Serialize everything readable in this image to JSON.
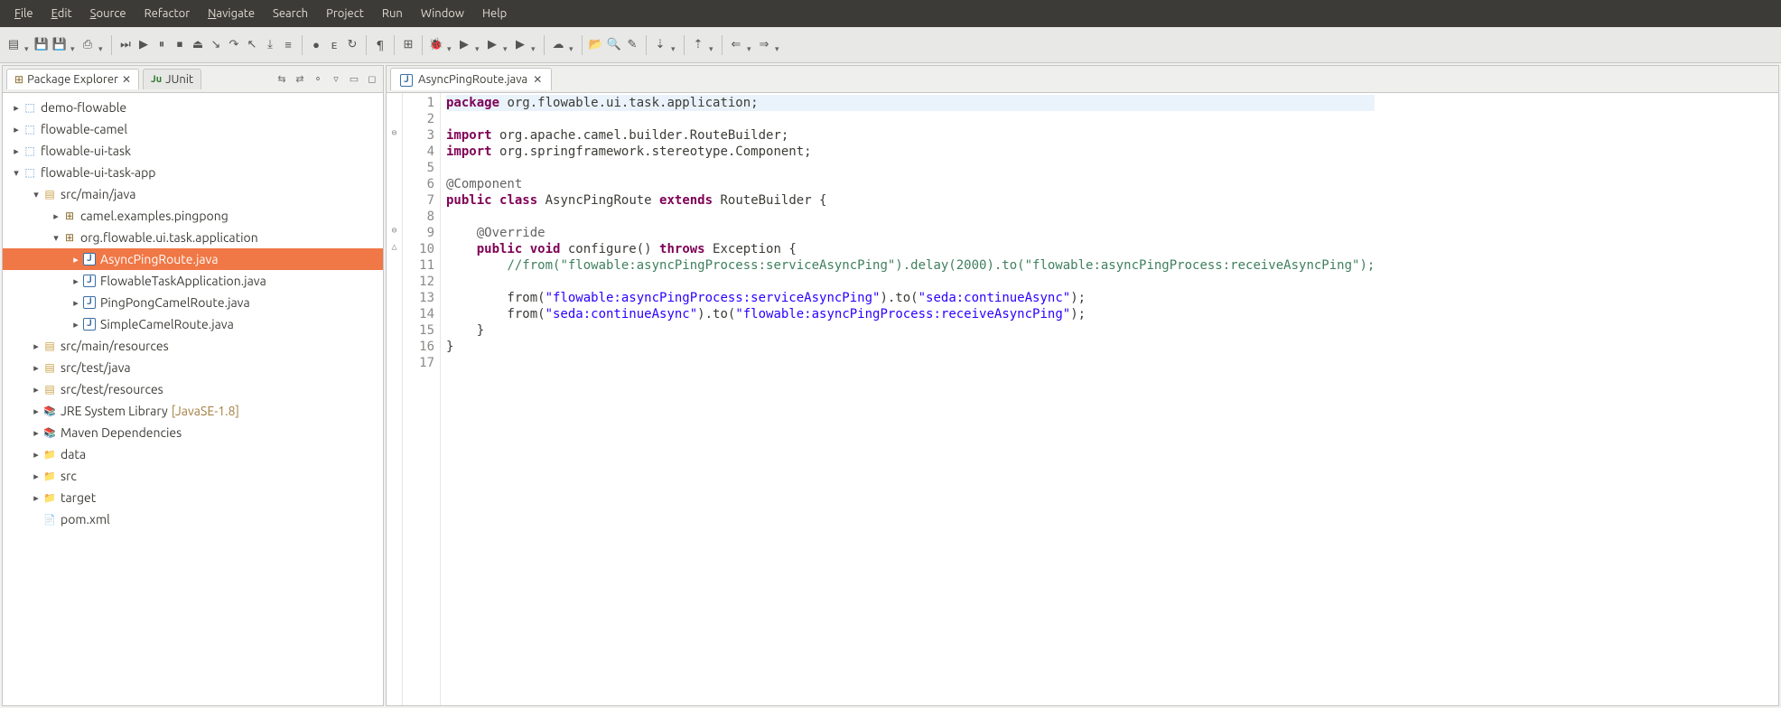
{
  "menu": [
    "File",
    "Edit",
    "Source",
    "Refactor",
    "Navigate",
    "Search",
    "Project",
    "Run",
    "Window",
    "Help"
  ],
  "menu_underline": [
    0,
    0,
    0,
    null,
    0,
    null,
    null,
    null,
    null,
    null
  ],
  "sidebar": {
    "tabs": [
      {
        "label": "Package Explorer",
        "active": true
      },
      {
        "label": "JUnit",
        "active": false
      }
    ]
  },
  "tree": [
    {
      "depth": 0,
      "arrow": "▸",
      "icon": "proj",
      "label": "demo-flowable"
    },
    {
      "depth": 0,
      "arrow": "▸",
      "icon": "proj",
      "label": "flowable-camel"
    },
    {
      "depth": 0,
      "arrow": "▸",
      "icon": "proj",
      "label": "flowable-ui-task"
    },
    {
      "depth": 0,
      "arrow": "▾",
      "icon": "proj",
      "label": "flowable-ui-task-app"
    },
    {
      "depth": 1,
      "arrow": "▾",
      "icon": "srcf",
      "label": "src/main/java"
    },
    {
      "depth": 2,
      "arrow": "▸",
      "icon": "pkg",
      "label": "camel.examples.pingpong"
    },
    {
      "depth": 2,
      "arrow": "▾",
      "icon": "pkg",
      "label": "org.flowable.ui.task.application"
    },
    {
      "depth": 3,
      "arrow": "▸",
      "icon": "jfile",
      "label": "AsyncPingRoute.java",
      "selected": true
    },
    {
      "depth": 3,
      "arrow": "▸",
      "icon": "jfile",
      "label": "FlowableTaskApplication.java"
    },
    {
      "depth": 3,
      "arrow": "▸",
      "icon": "jfile",
      "label": "PingPongCamelRoute.java"
    },
    {
      "depth": 3,
      "arrow": "▸",
      "icon": "jfile",
      "label": "SimpleCamelRoute.java"
    },
    {
      "depth": 1,
      "arrow": "▸",
      "icon": "srcf",
      "label": "src/main/resources"
    },
    {
      "depth": 1,
      "arrow": "▸",
      "icon": "srcf",
      "label": "src/test/java"
    },
    {
      "depth": 1,
      "arrow": "▸",
      "icon": "srcf",
      "label": "src/test/resources"
    },
    {
      "depth": 1,
      "arrow": "▸",
      "icon": "jar",
      "label": "JRE System Library",
      "suffix": "[JavaSE-1.8]"
    },
    {
      "depth": 1,
      "arrow": "▸",
      "icon": "jar",
      "label": "Maven Dependencies"
    },
    {
      "depth": 1,
      "arrow": "▸",
      "icon": "fold",
      "label": "data"
    },
    {
      "depth": 1,
      "arrow": "▸",
      "icon": "fold",
      "label": "src"
    },
    {
      "depth": 1,
      "arrow": "▸",
      "icon": "fold",
      "label": "target"
    },
    {
      "depth": 1,
      "arrow": "",
      "icon": "file",
      "label": "pom.xml"
    }
  ],
  "editor": {
    "tab_label": "AsyncPingRoute.java",
    "lines": [
      {
        "n": 1,
        "hl": true,
        "tokens": [
          [
            "kw",
            "package"
          ],
          [
            "",
            " org.flowable.ui.task.application;"
          ]
        ]
      },
      {
        "n": 2,
        "tokens": [
          [
            "",
            ""
          ]
        ]
      },
      {
        "n": 3,
        "marker": "⊖",
        "tokens": [
          [
            "kw",
            "import"
          ],
          [
            "",
            " org.apache.camel.builder.RouteBuilder;"
          ]
        ]
      },
      {
        "n": 4,
        "tokens": [
          [
            "kw",
            "import"
          ],
          [
            "",
            " org.springframework.stereotype.Component;"
          ]
        ]
      },
      {
        "n": 5,
        "tokens": [
          [
            "",
            ""
          ]
        ]
      },
      {
        "n": 6,
        "tokens": [
          [
            "ann",
            "@Component"
          ]
        ]
      },
      {
        "n": 7,
        "tokens": [
          [
            "kw",
            "public"
          ],
          [
            "",
            " "
          ],
          [
            "kw",
            "class"
          ],
          [
            "",
            " AsyncPingRoute "
          ],
          [
            "kw",
            "extends"
          ],
          [
            "",
            " RouteBuilder {"
          ]
        ]
      },
      {
        "n": 8,
        "tokens": [
          [
            "",
            ""
          ]
        ]
      },
      {
        "n": 9,
        "marker": "⊖",
        "tokens": [
          [
            "",
            "    "
          ],
          [
            "ann",
            "@Override"
          ]
        ]
      },
      {
        "n": 10,
        "marker": "△",
        "tokens": [
          [
            "",
            "    "
          ],
          [
            "kw",
            "public"
          ],
          [
            "",
            " "
          ],
          [
            "kw",
            "void"
          ],
          [
            "",
            " configure() "
          ],
          [
            "kw",
            "throws"
          ],
          [
            "",
            " Exception {"
          ]
        ]
      },
      {
        "n": 11,
        "tokens": [
          [
            "",
            "        "
          ],
          [
            "cmt",
            "//from(\"flowable:asyncPingProcess:serviceAsyncPing\").delay(2000).to(\"flowable:asyncPingProcess:receiveAsyncPing\");"
          ]
        ]
      },
      {
        "n": 12,
        "tokens": [
          [
            "",
            ""
          ]
        ]
      },
      {
        "n": 13,
        "tokens": [
          [
            "",
            "        from("
          ],
          [
            "str",
            "\"flowable:asyncPingProcess:serviceAsyncPing\""
          ],
          [
            "",
            ").to("
          ],
          [
            "str",
            "\"seda:continueAsync\""
          ],
          [
            "",
            ");"
          ]
        ]
      },
      {
        "n": 14,
        "tokens": [
          [
            "",
            "        from("
          ],
          [
            "str",
            "\"seda:continueAsync\""
          ],
          [
            "",
            ").to("
          ],
          [
            "str",
            "\"flowable:asyncPingProcess:receiveAsyncPing\""
          ],
          [
            "",
            ");"
          ]
        ]
      },
      {
        "n": 15,
        "tokens": [
          [
            "",
            "    }"
          ]
        ]
      },
      {
        "n": 16,
        "tokens": [
          [
            "",
            "}"
          ]
        ]
      },
      {
        "n": 17,
        "tokens": [
          [
            "",
            ""
          ]
        ]
      }
    ]
  },
  "toolbar_icons": [
    "new",
    "save",
    "save-all",
    "print",
    "",
    "skip",
    "debug-step",
    "pause",
    "stop",
    "disconnect",
    "step-into",
    "step-over",
    "step-return",
    "drop",
    "step-filter",
    "",
    "breakpoint",
    "expr",
    "last",
    "",
    "toggle",
    "",
    "new-pkg",
    "",
    "run-debug",
    "run",
    "coverage",
    "run-ext",
    "",
    "new-server",
    "",
    "open-type",
    "search",
    "task",
    "",
    "next",
    "",
    "prev",
    "",
    "back",
    "fwd"
  ]
}
